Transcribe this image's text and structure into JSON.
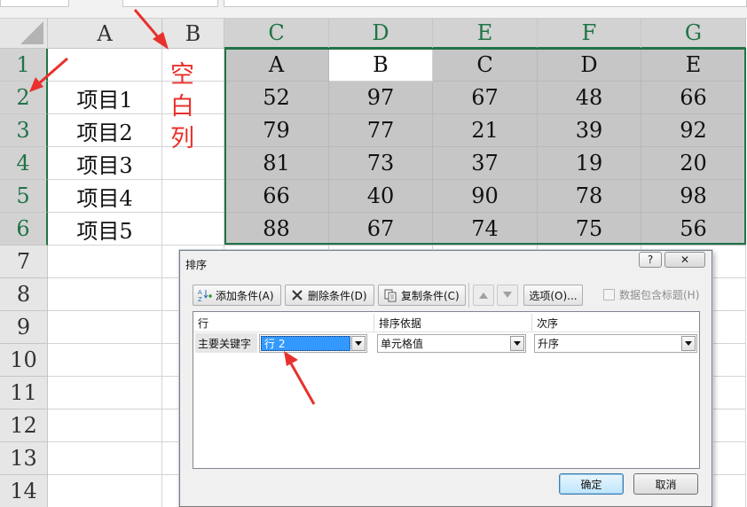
{
  "columns": [
    "A",
    "B",
    "C",
    "D",
    "E",
    "F",
    "G"
  ],
  "rows": [
    "1",
    "2",
    "3",
    "4",
    "5",
    "6",
    "7",
    "8",
    "9",
    "10",
    "11",
    "12",
    "13",
    "14"
  ],
  "sheet": {
    "header_row": [
      "A",
      "B",
      "C",
      "D",
      "E"
    ],
    "items": [
      "项目1",
      "项目2",
      "项目3",
      "项目4",
      "项目5"
    ],
    "values": [
      [
        52,
        97,
        67,
        48,
        66
      ],
      [
        79,
        77,
        21,
        39,
        92
      ],
      [
        81,
        73,
        37,
        19,
        20
      ],
      [
        66,
        40,
        90,
        78,
        98
      ],
      [
        88,
        67,
        74,
        75,
        56
      ]
    ]
  },
  "annotations": {
    "blank_column": [
      "空",
      "白",
      "列"
    ],
    "arrow_color": "#e8312c"
  },
  "dialog": {
    "title": "排序",
    "help_label": "?",
    "close_label": "✕",
    "toolbar": {
      "add_level": "添加条件(A)",
      "delete_level": "删除条件(D)",
      "copy_level": "复制条件(C)",
      "options": "选项(O)...",
      "has_headers": "数据包含标题(H)"
    },
    "headers": {
      "column": "行",
      "sort_on": "排序依据",
      "order": "次序"
    },
    "level": {
      "label": "主要关键字",
      "key": "行 2",
      "sort_on": "单元格值",
      "order": "升序"
    },
    "ok_label": "确定",
    "cancel_label": "取消"
  },
  "colors": {
    "selection_green": "#217346",
    "selected_fill": "#c6c6c6",
    "header_fill": "#e6e6e6"
  }
}
